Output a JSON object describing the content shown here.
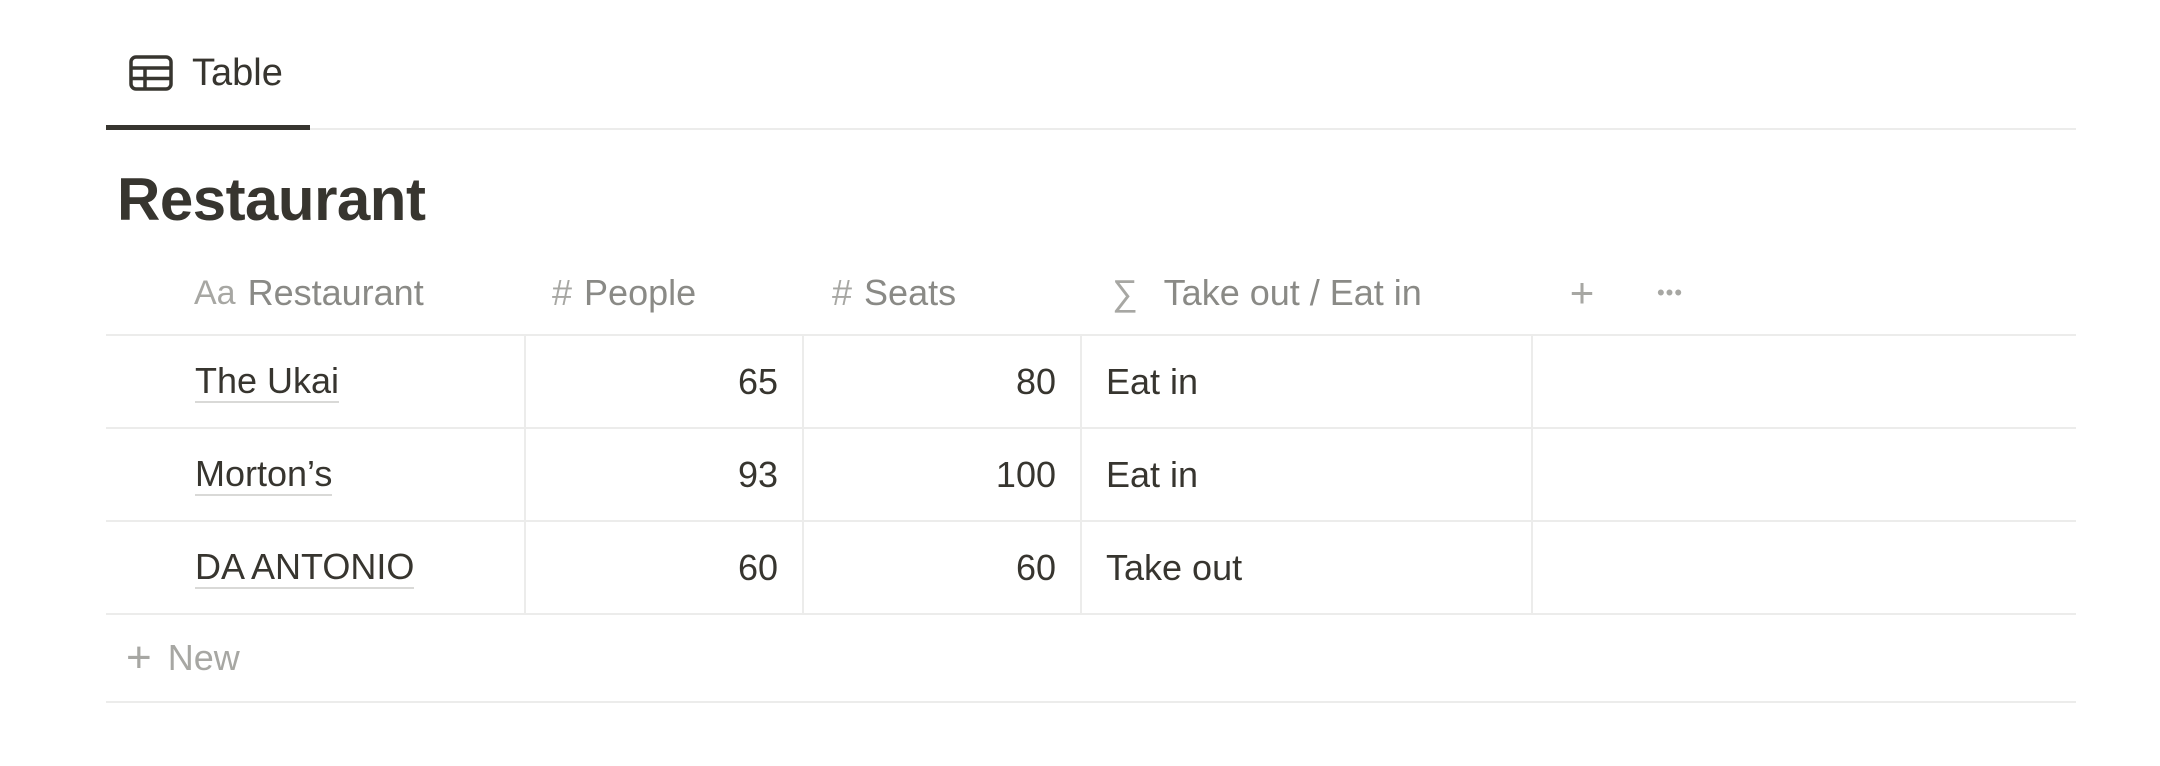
{
  "view": {
    "tab_label": "Table",
    "tab_icon": "table-icon"
  },
  "database": {
    "title": "Restaurant"
  },
  "table": {
    "columns": [
      {
        "label": "Restaurant",
        "icon": "text-property-icon",
        "icon_glyph": "Aa"
      },
      {
        "label": "People",
        "icon": "number-property-icon",
        "icon_glyph": "#"
      },
      {
        "label": "Seats",
        "icon": "number-property-icon",
        "icon_glyph": "#"
      },
      {
        "label": "Take out / Eat in",
        "icon": "formula-property-icon",
        "icon_glyph": "∑"
      }
    ],
    "add_column_glyph": "+",
    "more_glyph": "•••",
    "rows": [
      {
        "restaurant": "The Ukai",
        "people": "65",
        "seats": "80",
        "take_out_eat_in": "Eat in"
      },
      {
        "restaurant": "Morton’s",
        "people": "93",
        "seats": "100",
        "take_out_eat_in": "Eat in"
      },
      {
        "restaurant": "DA ANTONIO",
        "people": "60",
        "seats": "60",
        "take_out_eat_in": "Take out"
      }
    ],
    "new_row_glyph": "+",
    "new_row_label": "New"
  },
  "colors": {
    "text": "#37352f",
    "muted": "#8a8a86",
    "border": "#ececeb"
  }
}
